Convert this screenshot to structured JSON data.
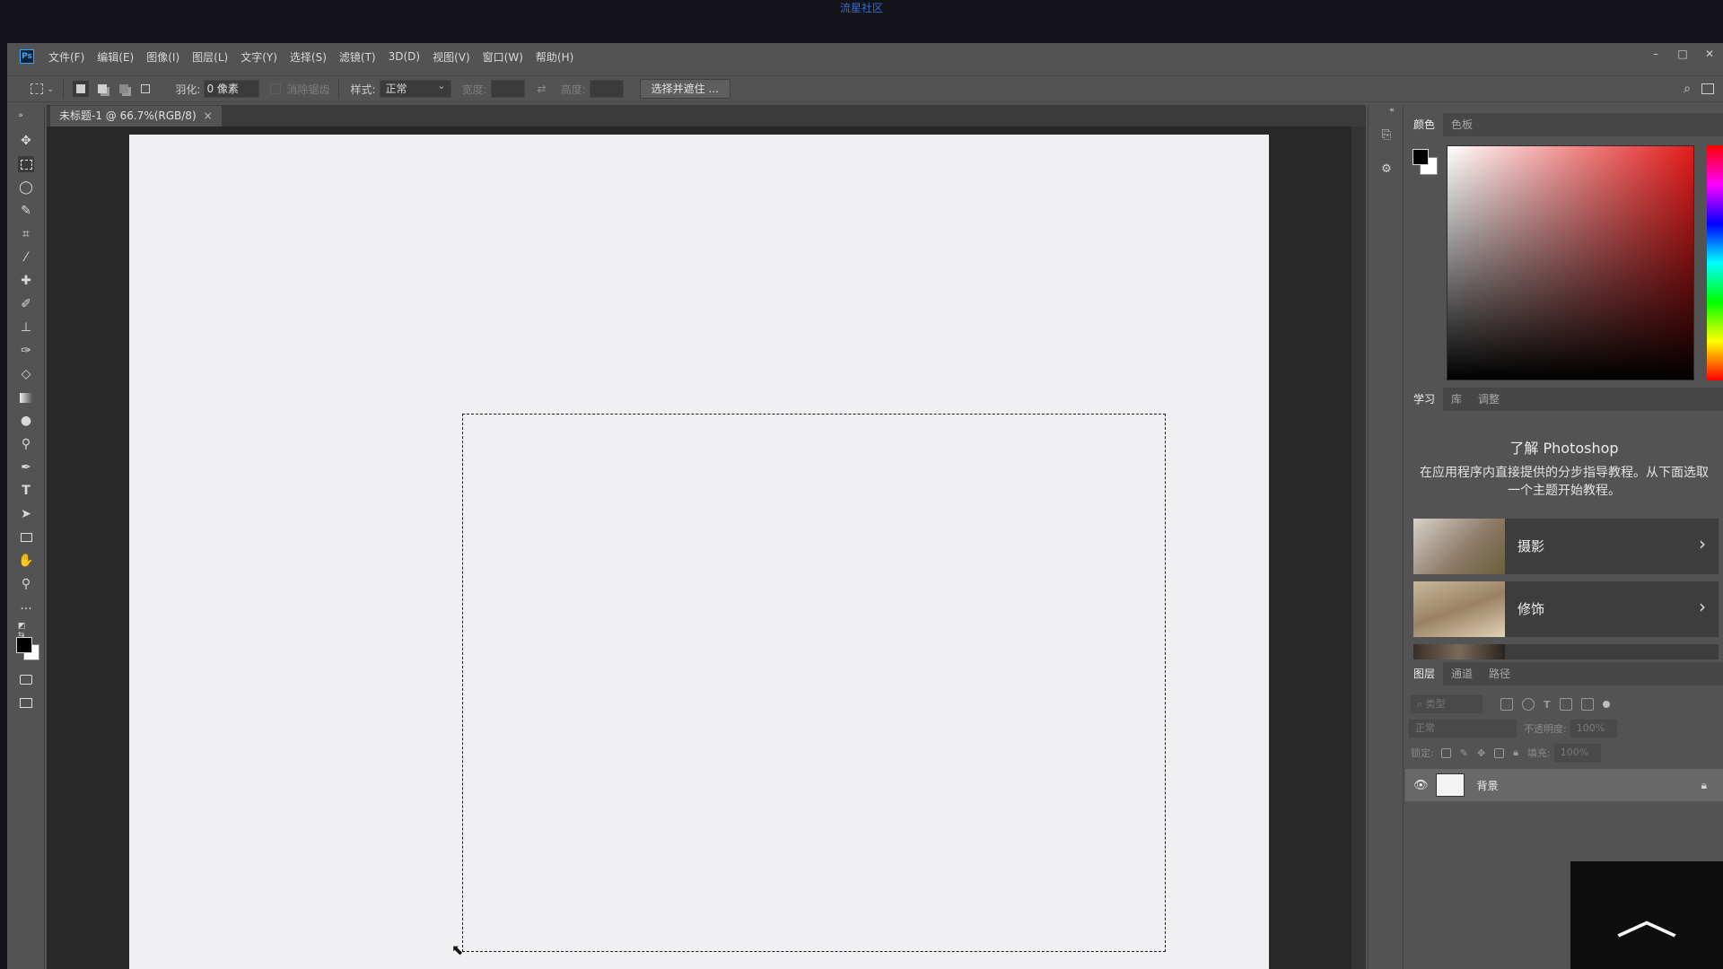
{
  "watermark": "流星社区",
  "menubar": {
    "logo": "Ps",
    "items": [
      "文件(F)",
      "编辑(E)",
      "图像(I)",
      "图层(L)",
      "文字(Y)",
      "选择(S)",
      "滤镜(T)",
      "3D(D)",
      "视图(V)",
      "窗口(W)",
      "帮助(H)"
    ],
    "window_controls": [
      "–",
      "□",
      "✕"
    ]
  },
  "options": {
    "feather_label": "羽化:",
    "feather_value": "0 像素",
    "antialias_label": "消除锯齿",
    "style_label": "样式:",
    "style_value": "正常",
    "width_label": "宽度:",
    "height_label": "高度:",
    "select_mask_button": "选择并遮住 ..."
  },
  "document": {
    "tab_title": "未标题-1 @ 66.7%(RGB/8)",
    "close": "×"
  },
  "panels": {
    "color_tabs": [
      "颜色",
      "色板"
    ],
    "learn_tabs": [
      "学习",
      "库",
      "调整"
    ],
    "learn_title": "了解 Photoshop",
    "learn_desc": "在应用程序内直接提供的分步指导教程。从下面选取一个主题开始教程。",
    "learn_cards": [
      "摄影",
      "修饰"
    ],
    "layer_tabs": [
      "图层",
      "通道",
      "路径"
    ],
    "layer_filter_placeholder": "类型",
    "blend_mode": "正常",
    "opacity_label": "不透明度:",
    "opacity_value": "100%",
    "lock_label": "锁定:",
    "fill_label": "填充:",
    "fill_value": "100%",
    "layer_name": "背景"
  },
  "colors": {
    "accent": "#31a8ff",
    "foreground": "#000000",
    "background": "#ffffff"
  }
}
